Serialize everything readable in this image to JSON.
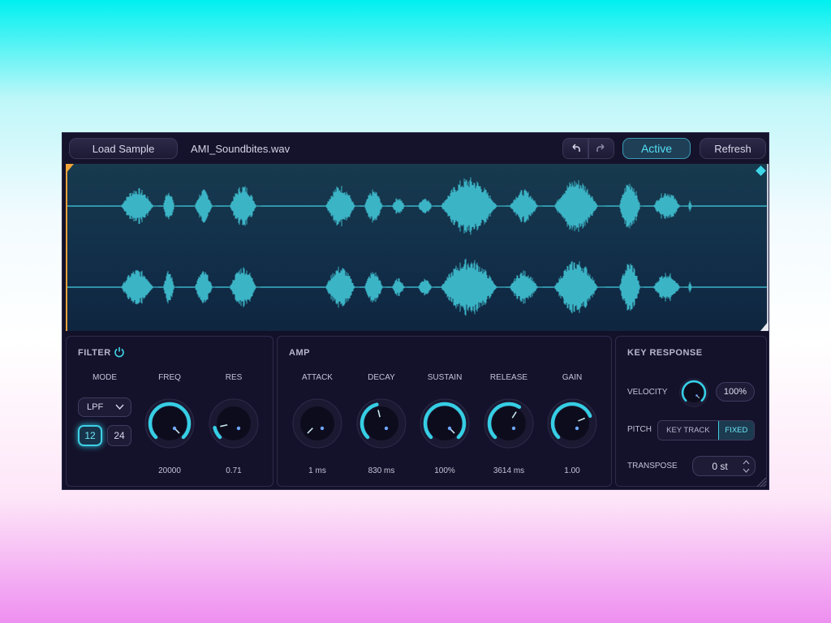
{
  "topbar": {
    "load_label": "Load Sample",
    "filename": "AMI_Soundbites.wav",
    "active_label": "Active",
    "refresh_label": "Refresh"
  },
  "filter": {
    "title": "FILTER",
    "mode_label": "MODE",
    "mode_value": "LPF",
    "slope_options": [
      "12",
      "24"
    ],
    "slope_selected": "12",
    "freq_label": "FREQ",
    "freq_value": "20000",
    "freq_level": 1.0,
    "res_label": "RES",
    "res_value": "0.71",
    "res_level": 0.12
  },
  "amp": {
    "title": "AMP",
    "knobs": [
      {
        "label": "ATTACK",
        "value": "1 ms",
        "level": 0.0
      },
      {
        "label": "DECAY",
        "value": "830 ms",
        "level": 0.45
      },
      {
        "label": "SUSTAIN",
        "value": "100%",
        "level": 1.0
      },
      {
        "label": "RELEASE",
        "value": "3614 ms",
        "level": 0.62
      },
      {
        "label": "GAIN",
        "value": "1.00",
        "level": 0.75
      }
    ]
  },
  "key_response": {
    "title": "KEY RESPONSE",
    "velocity_label": "VELOCITY",
    "velocity_value": "100%",
    "velocity_level": 1.0,
    "pitch_label": "PITCH",
    "pitch_options": [
      "KEY TRACK",
      "FIXED"
    ],
    "pitch_selected": "FIXED",
    "transpose_label": "TRANSPOSE",
    "transpose_value": "0 st"
  },
  "colors": {
    "accent": "#3fd6e8",
    "waveform": "#3bb4c6",
    "start_marker": "#f0a43a",
    "panel_bg": "#14122a"
  }
}
